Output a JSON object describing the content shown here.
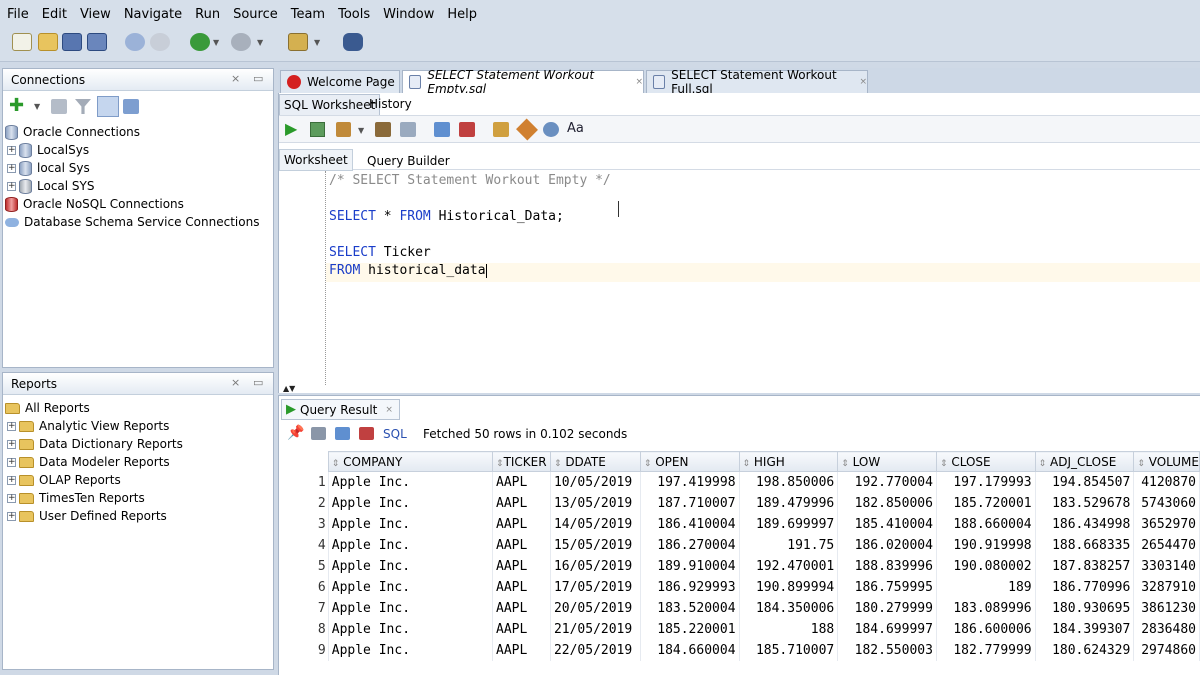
{
  "menu": [
    "File",
    "Edit",
    "View",
    "Navigate",
    "Run",
    "Source",
    "Team",
    "Tools",
    "Window",
    "Help"
  ],
  "connections_panel": {
    "title": "Connections",
    "items": [
      {
        "label": "Oracle Connections",
        "level": 0
      },
      {
        "label": "LocalSys",
        "level": 1
      },
      {
        "label": "local Sys",
        "level": 1
      },
      {
        "label": "Local SYS",
        "level": 1
      },
      {
        "label": "Oracle NoSQL Connections",
        "level": 0
      },
      {
        "label": "Database Schema Service Connections",
        "level": 0
      }
    ]
  },
  "reports_panel": {
    "title": "Reports",
    "items": [
      {
        "label": "All Reports"
      },
      {
        "label": "Analytic View Reports"
      },
      {
        "label": "Data Dictionary Reports"
      },
      {
        "label": "Data Modeler Reports"
      },
      {
        "label": "OLAP Reports"
      },
      {
        "label": "TimesTen Reports"
      },
      {
        "label": "User Defined Reports"
      }
    ]
  },
  "doc_tabs": [
    {
      "label": "Welcome Page",
      "active": false
    },
    {
      "label": "SELECT Statement Workout Empty.sql",
      "active": true
    },
    {
      "label": "SELECT Statement Workout Full.sql",
      "active": false
    }
  ],
  "editor": {
    "tabs": [
      "SQL Worksheet",
      "History"
    ],
    "subtabs": [
      "Worksheet",
      "Query Builder"
    ],
    "lines": {
      "comment": "/* SELECT Statement Workout Empty */",
      "l3_kw": "SELECT",
      "l3_rest": " * ",
      "l3_kw2": "FROM",
      "l3_rest2": " Historical_Data;",
      "l5_kw": "SELECT",
      "l5_rest": " Ticker",
      "l6_kw": "FROM",
      "l6_rest": " historical_data"
    }
  },
  "results": {
    "tab_label": "Query Result",
    "sql_link": "SQL",
    "status": "Fetched 50 rows in 0.102 seconds",
    "columns": [
      "COMPANY",
      "TICKER",
      "DDATE",
      "OPEN",
      "HIGH",
      "LOW",
      "CLOSE",
      "ADJ_CLOSE",
      "VOLUME"
    ],
    "rows": [
      [
        "1",
        "Apple Inc.",
        "AAPL",
        "10/05/2019",
        "197.419998",
        "198.850006",
        "192.770004",
        "197.179993",
        "194.854507",
        "4120870"
      ],
      [
        "2",
        "Apple Inc.",
        "AAPL",
        "13/05/2019",
        "187.710007",
        "189.479996",
        "182.850006",
        "185.720001",
        "183.529678",
        "5743060"
      ],
      [
        "3",
        "Apple Inc.",
        "AAPL",
        "14/05/2019",
        "186.410004",
        "189.699997",
        "185.410004",
        "188.660004",
        "186.434998",
        "3652970"
      ],
      [
        "4",
        "Apple Inc.",
        "AAPL",
        "15/05/2019",
        "186.270004",
        "191.75",
        "186.020004",
        "190.919998",
        "188.668335",
        "2654470"
      ],
      [
        "5",
        "Apple Inc.",
        "AAPL",
        "16/05/2019",
        "189.910004",
        "192.470001",
        "188.839996",
        "190.080002",
        "187.838257",
        "3303140"
      ],
      [
        "6",
        "Apple Inc.",
        "AAPL",
        "17/05/2019",
        "186.929993",
        "190.899994",
        "186.759995",
        "189",
        "186.770996",
        "3287910"
      ],
      [
        "7",
        "Apple Inc.",
        "AAPL",
        "20/05/2019",
        "183.520004",
        "184.350006",
        "180.279999",
        "183.089996",
        "180.930695",
        "3861230"
      ],
      [
        "8",
        "Apple Inc.",
        "AAPL",
        "21/05/2019",
        "185.220001",
        "188",
        "184.699997",
        "186.600006",
        "184.399307",
        "2836480"
      ],
      [
        "9",
        "Apple Inc.",
        "AAPL",
        "22/05/2019",
        "184.660004",
        "185.710007",
        "182.550003",
        "182.779999",
        "180.624329",
        "2974860"
      ]
    ]
  }
}
